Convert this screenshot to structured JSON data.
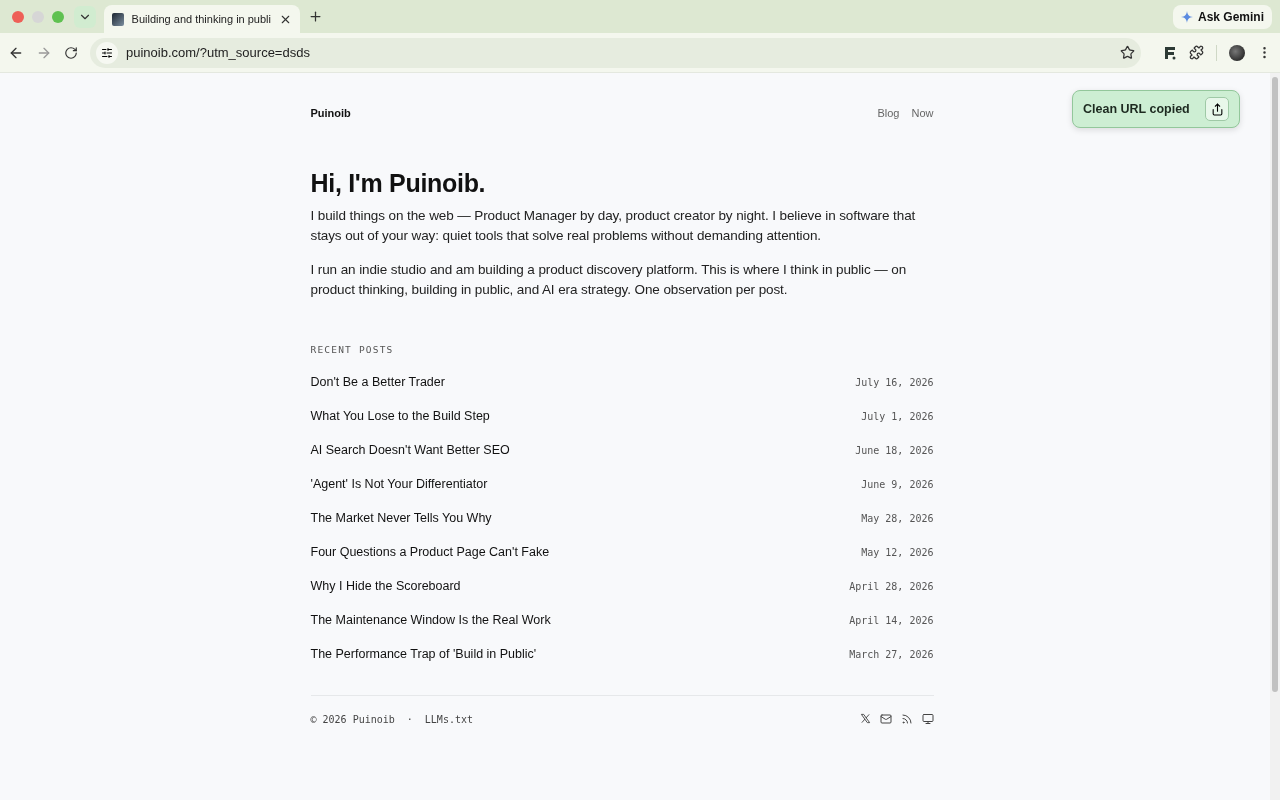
{
  "browser": {
    "tab": {
      "title": "Building and thinking in publi",
      "selected": true
    },
    "address": "puinoib.com/?utm_source=dsds",
    "ask_button": "Ask Gemini"
  },
  "site": {
    "name": "Puinoib",
    "nav": [
      {
        "label": "Blog"
      },
      {
        "label": "Now"
      }
    ]
  },
  "toast": {
    "message": "Clean URL copied"
  },
  "hero": {
    "title": "Hi, I'm Puinoib.",
    "paragraphs": [
      "I build things on the web — Product Manager by day, product creator by night. I believe in software that stays out of your way: quiet tools that solve real problems without demanding attention.",
      "I run an indie studio and am building a product discovery platform. This is where I think in public — on product thinking, building in public, and AI era strategy. One observation per post."
    ]
  },
  "recent_posts": {
    "heading": "RECENT POSTS",
    "posts": [
      {
        "title": "Don't Be a Better Trader",
        "date": "July 16, 2026"
      },
      {
        "title": "What You Lose to the Build Step",
        "date": "July 1, 2026"
      },
      {
        "title": "AI Search Doesn't Want Better SEO",
        "date": "June 18, 2026"
      },
      {
        "title": "'Agent' Is Not Your Differentiator",
        "date": "June 9, 2026"
      },
      {
        "title": "The Market Never Tells You Why",
        "date": "May 28, 2026"
      },
      {
        "title": "Four Questions a Product Page Can't Fake",
        "date": "May 12, 2026"
      },
      {
        "title": "Why I Hide the Scoreboard",
        "date": "April 28, 2026"
      },
      {
        "title": "The Maintenance Window Is the Real Work",
        "date": "April 14, 2026"
      },
      {
        "title": "The Performance Trap of 'Build in Public'",
        "date": "March 27, 2026"
      }
    ]
  },
  "footer": {
    "copyright": "© 2026 Puinoib",
    "separator": "·",
    "link": "LLMs.txt",
    "icons": [
      {
        "kind": "x"
      },
      {
        "kind": "mail"
      },
      {
        "kind": "rss"
      },
      {
        "kind": "monitor"
      }
    ]
  }
}
